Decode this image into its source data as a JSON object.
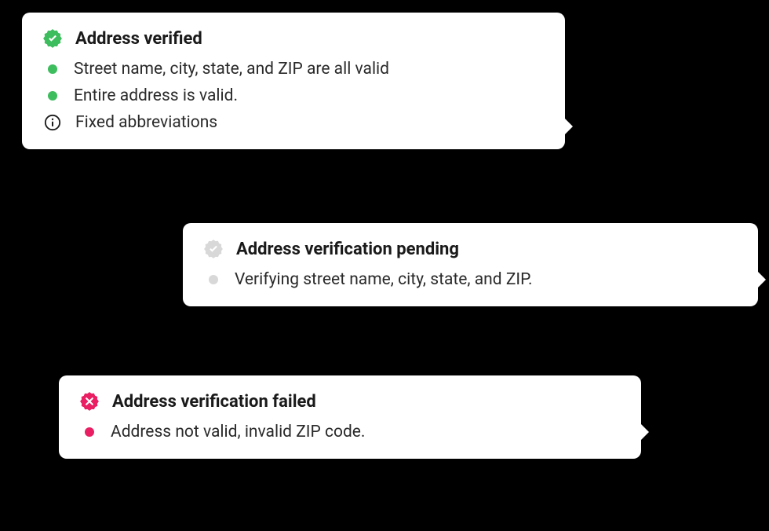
{
  "verified": {
    "title": "Address verified",
    "items": [
      {
        "type": "dot",
        "color": "green",
        "text": "Street name, city, state, and ZIP are all valid"
      },
      {
        "type": "dot",
        "color": "green",
        "text": "Entire address is valid."
      },
      {
        "type": "info",
        "text": "Fixed abbreviations"
      }
    ]
  },
  "pending": {
    "title": "Address verification pending",
    "items": [
      {
        "type": "dot",
        "color": "gray",
        "text": "Verifying street name, city, state, and ZIP."
      }
    ]
  },
  "failed": {
    "title": "Address verification failed",
    "items": [
      {
        "type": "dot",
        "color": "red",
        "text": "Address not valid, invalid ZIP code."
      }
    ]
  }
}
